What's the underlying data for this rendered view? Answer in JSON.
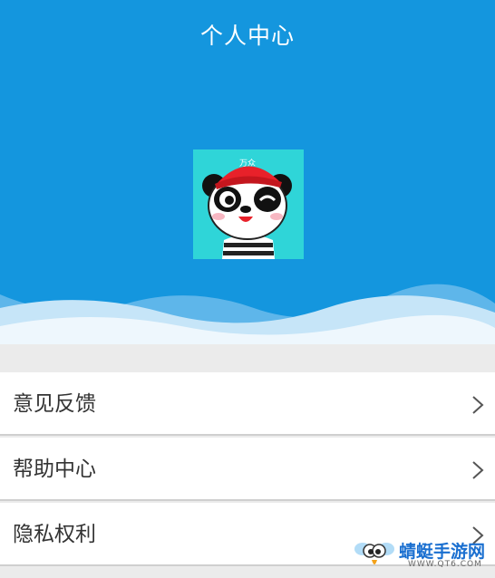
{
  "header": {
    "title": "个人中心"
  },
  "avatar": {
    "hat_text": "万众"
  },
  "menu": [
    {
      "label": "意见反馈"
    },
    {
      "label": "帮助中心"
    },
    {
      "label": "隐私权利"
    }
  ],
  "watermark": {
    "text": "蜻蜓手游网",
    "url": "WWW.QT6.COM"
  },
  "colors": {
    "header": "#1496de",
    "avatar_bg": "#2fd5d8",
    "cap_red": "#e8212a"
  }
}
